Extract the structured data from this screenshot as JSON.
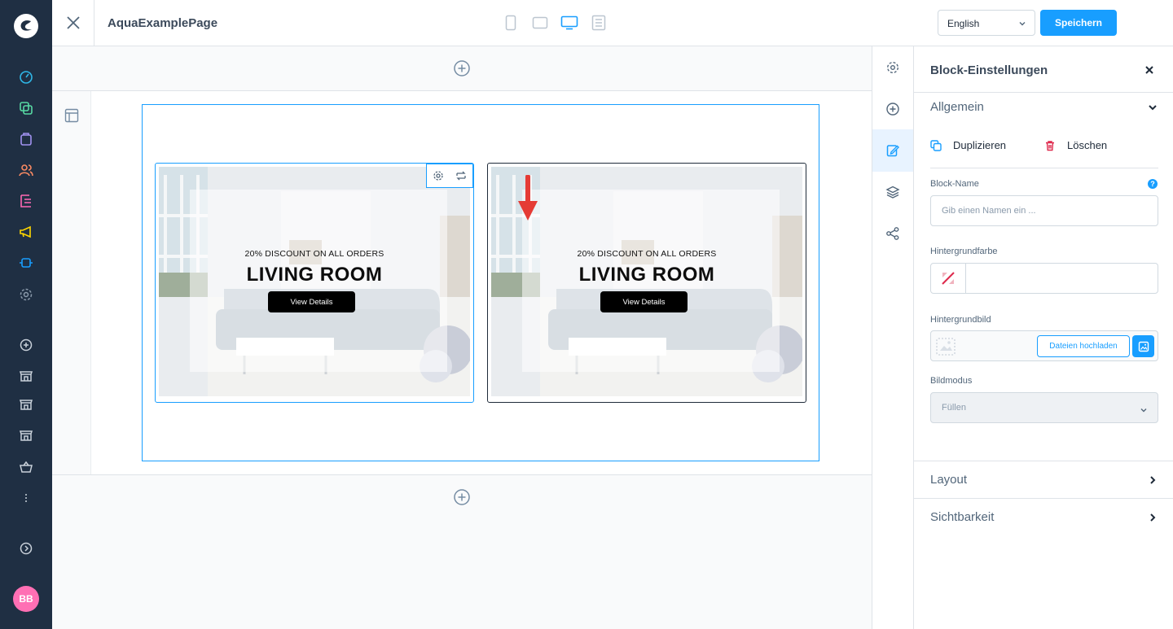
{
  "topbar": {
    "page_name": "AquaExamplePage",
    "language": "English",
    "save_label": "Speichern"
  },
  "canvas": {
    "cards": [
      {
        "subtitle": "20% DISCOUNT ON ALL ORDERS",
        "title": "LIVING ROOM",
        "button": "View Details"
      },
      {
        "subtitle": "20% DISCOUNT ON ALL ORDERS",
        "title": "LIVING ROOM",
        "button": "View Details"
      }
    ]
  },
  "panel": {
    "title": "Block-Einstellungen",
    "section_general": "Allgemein",
    "duplicate": "Duplizieren",
    "delete": "Löschen",
    "block_name_label": "Block-Name",
    "block_name_placeholder": "Gib einen Namen ein ...",
    "bg_color_label": "Hintergrundfarbe",
    "bg_image_label": "Hintergrundbild",
    "upload_label": "Dateien hochladen",
    "image_mode_label": "Bildmodus",
    "image_mode_value": "Füllen",
    "section_layout": "Layout",
    "section_visibility": "Sichtbarkeit"
  },
  "user": {
    "initials": "BB"
  },
  "colors": {
    "accent": "#189eff",
    "rail": "#1f2f43",
    "avatar": "#ff6fb4",
    "delete": "#de294c"
  }
}
